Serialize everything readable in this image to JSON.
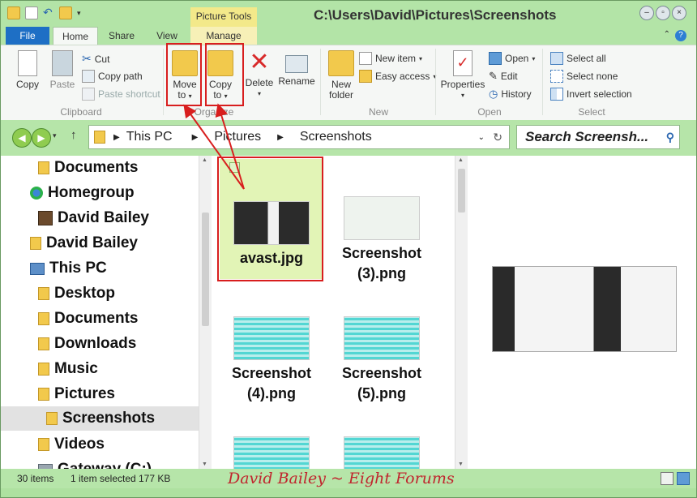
{
  "window": {
    "title": "C:\\Users\\David\\Pictures\\Screenshots",
    "context_tab_group": "Picture Tools",
    "controls": [
      "minimize-icon",
      "restore-icon",
      "close-icon"
    ]
  },
  "tabs": [
    {
      "label": "File"
    },
    {
      "label": "Home"
    },
    {
      "label": "Share"
    },
    {
      "label": "View"
    },
    {
      "label": "Manage"
    }
  ],
  "ribbon": {
    "clipboard": {
      "label": "Clipboard",
      "copy": "Copy",
      "paste": "Paste",
      "cut": "Cut",
      "copy_path": "Copy path",
      "paste_shortcut": "Paste shortcut"
    },
    "organize": {
      "label": "Organize",
      "move_to_l1": "Move",
      "move_to_l2": "to",
      "copy_to_l1": "Copy",
      "copy_to_l2": "to",
      "delete": "Delete",
      "rename": "Rename"
    },
    "new": {
      "label": "New",
      "new_folder_l1": "New",
      "new_folder_l2": "folder",
      "new_item": "New item",
      "easy_access": "Easy access"
    },
    "open": {
      "label": "Open",
      "properties": "Properties",
      "open": "Open",
      "edit": "Edit",
      "history": "History"
    },
    "select": {
      "label": "Select",
      "select_all": "Select all",
      "select_none": "Select none",
      "invert_selection": "Invert selection"
    }
  },
  "address": {
    "crumbs": [
      "This PC",
      "Pictures",
      "Screenshots"
    ],
    "search_placeholder": "Search Screensh..."
  },
  "nav": [
    {
      "label": "Documents"
    },
    {
      "label": "Homegroup"
    },
    {
      "label": "David Bailey"
    },
    {
      "label": "David Bailey"
    },
    {
      "label": "This PC"
    },
    {
      "label": "Desktop"
    },
    {
      "label": "Documents"
    },
    {
      "label": "Downloads"
    },
    {
      "label": "Music"
    },
    {
      "label": "Pictures"
    },
    {
      "label": "Screenshots"
    },
    {
      "label": "Videos"
    },
    {
      "label": "Gateway (C:)"
    }
  ],
  "files": [
    {
      "name": "avast.jpg"
    },
    {
      "name": "Screenshot (3).png"
    },
    {
      "name": "Screenshot (4).png"
    },
    {
      "name": "Screenshot (5).png"
    }
  ],
  "status": {
    "items": "30 items",
    "selected": "1 item selected",
    "size": "177 KB"
  },
  "watermark": "David Bailey ~ Eight Forums",
  "colors": {
    "accent_green": "#aee1a0",
    "file_tab_blue": "#1e6fc5",
    "annotation_red": "#d81e1e",
    "context_yellow": "#f3e98a"
  }
}
